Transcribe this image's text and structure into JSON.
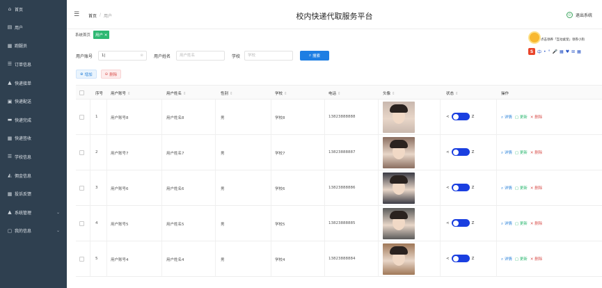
{
  "sidebar": {
    "items": [
      {
        "label": "首页",
        "icon": "home-icon",
        "glyph": "⌂"
      },
      {
        "label": "用户",
        "icon": "user-icon",
        "glyph": "▤"
      },
      {
        "label": "跑腿员",
        "icon": "runner-icon",
        "glyph": "▦"
      },
      {
        "label": "订单信息",
        "icon": "order-icon",
        "glyph": "☰"
      },
      {
        "label": "快递接单",
        "icon": "person-icon",
        "glyph": "▲"
      },
      {
        "label": "快递配送",
        "icon": "delivery-icon",
        "glyph": "▣"
      },
      {
        "label": "快递完成",
        "icon": "complete-icon",
        "glyph": "▬"
      },
      {
        "label": "快递签收",
        "icon": "grid-icon",
        "glyph": "▦"
      },
      {
        "label": "学校信息",
        "icon": "list-icon",
        "glyph": "☰"
      },
      {
        "label": "佣金信息",
        "icon": "money-icon",
        "glyph": "◭"
      },
      {
        "label": "投诉反馈",
        "icon": "grid-icon",
        "glyph": "▦"
      },
      {
        "label": "系统管理",
        "icon": "system-icon",
        "glyph": "▲",
        "has_chevron": true
      },
      {
        "label": "我的信息",
        "icon": "profile-icon",
        "glyph": "▢",
        "has_chevron": true
      }
    ]
  },
  "header": {
    "breadcrumb_home": "首页",
    "breadcrumb_sep": "/",
    "breadcrumb_current": "用户",
    "title": "校内快递代取服务平台",
    "logout": "退出系统"
  },
  "tags": {
    "home": "系统首页",
    "active": "用户 ✕"
  },
  "widget": {
    "text": "点击领养「互动桌宠」领券小狗",
    "ime_s": "S",
    "ime_items": [
      "中",
      "•",
      "°",
      "🎤",
      "▦",
      "♥",
      "⊞",
      "▦"
    ]
  },
  "search": {
    "account_label": "用户账号",
    "account_value": "1|",
    "name_label": "用户姓名",
    "name_placeholder": "用户姓名",
    "school_label": "学校",
    "school_placeholder": "学校",
    "button": "搜索"
  },
  "actions": {
    "add": "增加",
    "delete": "删除"
  },
  "table": {
    "columns": [
      "序号",
      "用户账号",
      "用户姓名",
      "性别",
      "学校",
      "电话",
      "头像",
      "状态",
      "操作"
    ],
    "rows": [
      {
        "index": "1",
        "account": "用户账号8",
        "name": "用户姓名8",
        "gender": "男",
        "school": "学校8",
        "phone": "13823888888",
        "avatar_color": "#c9b8ae"
      },
      {
        "index": "2",
        "account": "用户账号7",
        "name": "用户姓名7",
        "gender": "男",
        "school": "学校7",
        "phone": "13823888887",
        "avatar_color": "#8a6e60"
      },
      {
        "index": "3",
        "account": "用户账号6",
        "name": "用户姓名6",
        "gender": "男",
        "school": "学校6",
        "phone": "13823888886",
        "avatar_color": "#3b3b44"
      },
      {
        "index": "4",
        "account": "用户账号5",
        "name": "用户姓名5",
        "gender": "男",
        "school": "学校5",
        "phone": "13823888885",
        "avatar_color": "#5a5a5a"
      },
      {
        "index": "5",
        "account": "用户账号4",
        "name": "用户姓名4",
        "gender": "男",
        "school": "学校4",
        "phone": "13823888884",
        "avatar_color": "#a07858"
      }
    ],
    "switch_left": "<",
    "switch_right": "Z",
    "op_detail": "详情",
    "op_update": "更新",
    "op_delete": "删除"
  },
  "colors": {
    "sidebar_bg": "#2f4050",
    "primary": "#1e7ee3",
    "tag_green": "#2eb872",
    "switch_on": "#1a3fe0",
    "danger": "#d9534f"
  }
}
